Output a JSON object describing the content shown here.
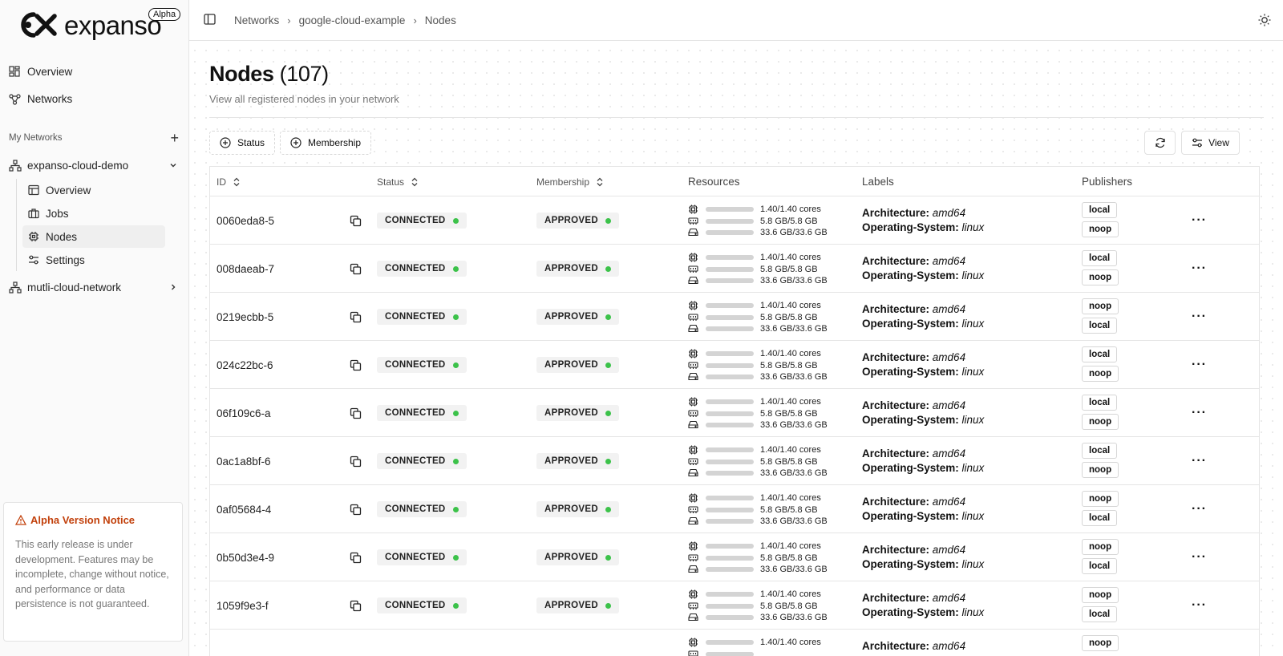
{
  "brand": {
    "name": "expanso",
    "badge": "Alpha"
  },
  "sidebar": {
    "nav": [
      {
        "label": "Overview",
        "icon": "dashboard-icon"
      },
      {
        "label": "Networks",
        "icon": "network-icon"
      }
    ],
    "section_label": "My Networks",
    "networks": [
      {
        "label": "expanso-cloud-demo",
        "expanded": true,
        "children": [
          {
            "label": "Overview",
            "icon": "overview-icon"
          },
          {
            "label": "Jobs",
            "icon": "briefcase-icon"
          },
          {
            "label": "Nodes",
            "icon": "chip-icon",
            "active": true
          },
          {
            "label": "Settings",
            "icon": "sliders-icon"
          }
        ]
      },
      {
        "label": "mutli-cloud-network",
        "expanded": false
      }
    ],
    "notice": {
      "title": "Alpha Version Notice",
      "body": "This early release is under development. Features may be incomplete, change without notice, and performance or data persistence is not guaranteed."
    }
  },
  "breadcrumb": [
    "Networks",
    "google-cloud-example",
    "Nodes"
  ],
  "page": {
    "title": "Nodes",
    "count": "(107)",
    "subtitle": "View all registered nodes in your network"
  },
  "toolbar": {
    "status_filter": "Status",
    "membership_filter": "Membership",
    "view_label": "View"
  },
  "table": {
    "columns": [
      "ID",
      "Status",
      "Membership",
      "Resources",
      "Labels",
      "Publishers"
    ],
    "label_keys": {
      "arch": "Architecture:",
      "os": "Operating-System:"
    },
    "rows": [
      {
        "id": "0060eda8-5",
        "status": "CONNECTED",
        "membership": "APPROVED",
        "cpu": "1.40/1.40 cores",
        "mem": "5.8 GB/5.8 GB",
        "disk": "33.6 GB/33.6 GB",
        "arch": "amd64",
        "os": "linux",
        "pubs": [
          "local",
          "noop"
        ]
      },
      {
        "id": "008daeab-7",
        "status": "CONNECTED",
        "membership": "APPROVED",
        "cpu": "1.40/1.40 cores",
        "mem": "5.8 GB/5.8 GB",
        "disk": "33.6 GB/33.6 GB",
        "arch": "amd64",
        "os": "linux",
        "pubs": [
          "local",
          "noop"
        ]
      },
      {
        "id": "0219ecbb-5",
        "status": "CONNECTED",
        "membership": "APPROVED",
        "cpu": "1.40/1.40 cores",
        "mem": "5.8 GB/5.8 GB",
        "disk": "33.6 GB/33.6 GB",
        "arch": "amd64",
        "os": "linux",
        "pubs": [
          "noop",
          "local"
        ]
      },
      {
        "id": "024c22bc-6",
        "status": "CONNECTED",
        "membership": "APPROVED",
        "cpu": "1.40/1.40 cores",
        "mem": "5.8 GB/5.8 GB",
        "disk": "33.6 GB/33.6 GB",
        "arch": "amd64",
        "os": "linux",
        "pubs": [
          "local",
          "noop"
        ]
      },
      {
        "id": "06f109c6-a",
        "status": "CONNECTED",
        "membership": "APPROVED",
        "cpu": "1.40/1.40 cores",
        "mem": "5.8 GB/5.8 GB",
        "disk": "33.6 GB/33.6 GB",
        "arch": "amd64",
        "os": "linux",
        "pubs": [
          "local",
          "noop"
        ]
      },
      {
        "id": "0ac1a8bf-6",
        "status": "CONNECTED",
        "membership": "APPROVED",
        "cpu": "1.40/1.40 cores",
        "mem": "5.8 GB/5.8 GB",
        "disk": "33.6 GB/33.6 GB",
        "arch": "amd64",
        "os": "linux",
        "pubs": [
          "local",
          "noop"
        ]
      },
      {
        "id": "0af05684-4",
        "status": "CONNECTED",
        "membership": "APPROVED",
        "cpu": "1.40/1.40 cores",
        "mem": "5.8 GB/5.8 GB",
        "disk": "33.6 GB/33.6 GB",
        "arch": "amd64",
        "os": "linux",
        "pubs": [
          "noop",
          "local"
        ]
      },
      {
        "id": "0b50d3e4-9",
        "status": "CONNECTED",
        "membership": "APPROVED",
        "cpu": "1.40/1.40 cores",
        "mem": "5.8 GB/5.8 GB",
        "disk": "33.6 GB/33.6 GB",
        "arch": "amd64",
        "os": "linux",
        "pubs": [
          "noop",
          "local"
        ]
      },
      {
        "id": "1059f9e3-f",
        "status": "CONNECTED",
        "membership": "APPROVED",
        "cpu": "1.40/1.40 cores",
        "mem": "5.8 GB/5.8 GB",
        "disk": "33.6 GB/33.6 GB",
        "arch": "amd64",
        "os": "linux",
        "pubs": [
          "noop",
          "local"
        ]
      },
      {
        "id": "",
        "status": "",
        "membership": "",
        "cpu": "1.40/1.40 cores",
        "mem": "",
        "disk": "",
        "arch": "amd64",
        "os": "",
        "pubs": [
          "noop"
        ]
      }
    ]
  },
  "colors": {
    "status_dot": "#3cc24a",
    "notice_title": "#c2410c"
  }
}
